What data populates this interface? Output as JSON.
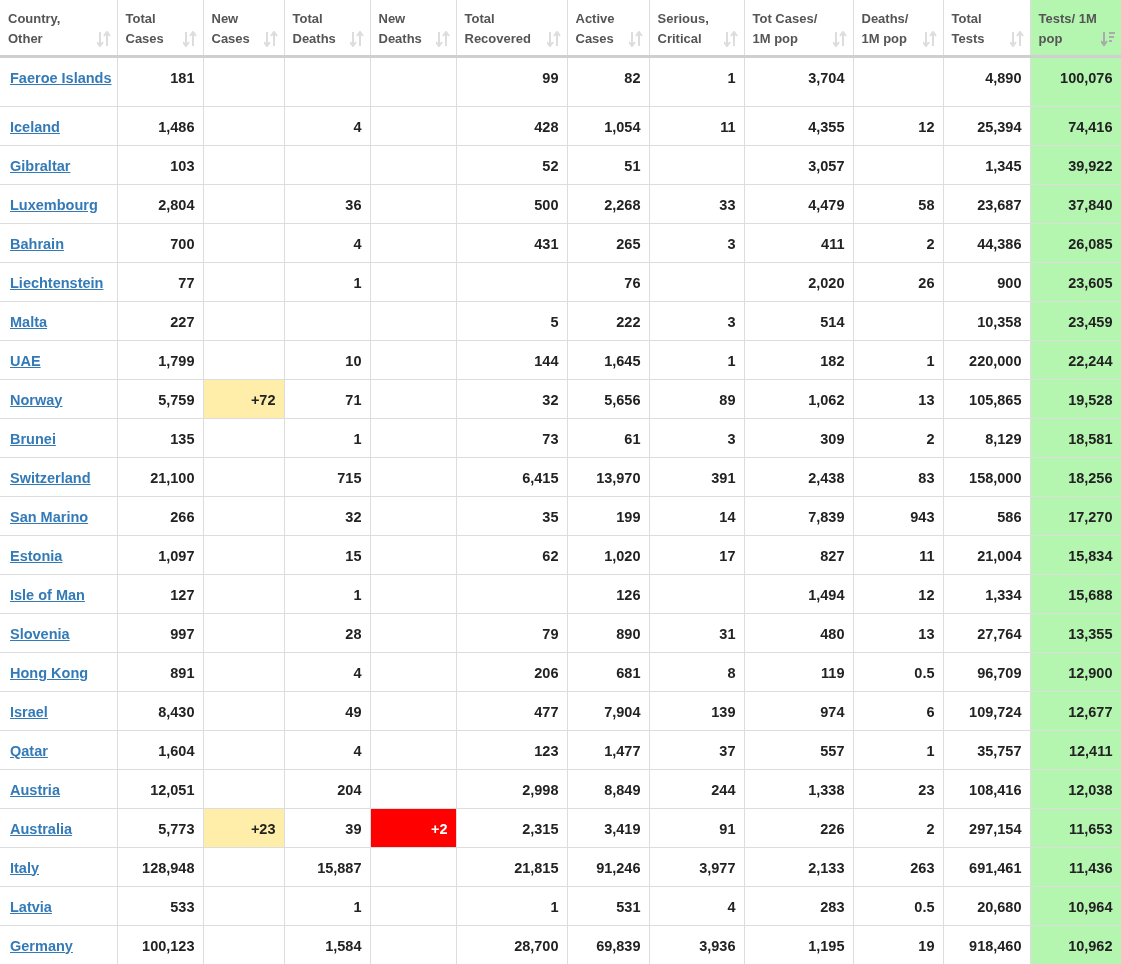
{
  "table": {
    "columns": [
      {
        "label": "Country, Other",
        "kind": "country",
        "sorted": false
      },
      {
        "label": "Total Cases",
        "kind": "number",
        "sorted": false
      },
      {
        "label": "New Cases",
        "kind": "new_cases",
        "sorted": false
      },
      {
        "label": "Total Deaths",
        "kind": "number",
        "sorted": false
      },
      {
        "label": "New Deaths",
        "kind": "new_deaths",
        "sorted": false
      },
      {
        "label": "Total Recovered",
        "kind": "number",
        "sorted": false
      },
      {
        "label": "Active Cases",
        "kind": "number",
        "sorted": false
      },
      {
        "label": "Serious, Critical",
        "kind": "number",
        "sorted": false
      },
      {
        "label": "Tot Cases/ 1M pop",
        "kind": "number",
        "sorted": false
      },
      {
        "label": "Deaths/ 1M pop",
        "kind": "number",
        "sorted": false
      },
      {
        "label": "Total Tests",
        "kind": "number",
        "sorted": false
      },
      {
        "label": "Tests/ 1M pop",
        "kind": "number",
        "sorted": true
      }
    ],
    "rows": [
      [
        "Faeroe Islands",
        "181",
        "",
        "",
        "",
        "99",
        "82",
        "1",
        "3,704",
        "",
        "4,890",
        "100,076"
      ],
      [
        "Iceland",
        "1,486",
        "",
        "4",
        "",
        "428",
        "1,054",
        "11",
        "4,355",
        "12",
        "25,394",
        "74,416"
      ],
      [
        "Gibraltar",
        "103",
        "",
        "",
        "",
        "52",
        "51",
        "",
        "3,057",
        "",
        "1,345",
        "39,922"
      ],
      [
        "Luxembourg",
        "2,804",
        "",
        "36",
        "",
        "500",
        "2,268",
        "33",
        "4,479",
        "58",
        "23,687",
        "37,840"
      ],
      [
        "Bahrain",
        "700",
        "",
        "4",
        "",
        "431",
        "265",
        "3",
        "411",
        "2",
        "44,386",
        "26,085"
      ],
      [
        "Liechtenstein",
        "77",
        "",
        "1",
        "",
        "",
        "76",
        "",
        "2,020",
        "26",
        "900",
        "23,605"
      ],
      [
        "Malta",
        "227",
        "",
        "",
        "",
        "5",
        "222",
        "3",
        "514",
        "",
        "10,358",
        "23,459"
      ],
      [
        "UAE",
        "1,799",
        "",
        "10",
        "",
        "144",
        "1,645",
        "1",
        "182",
        "1",
        "220,000",
        "22,244"
      ],
      [
        "Norway",
        "5,759",
        "+72",
        "71",
        "",
        "32",
        "5,656",
        "89",
        "1,062",
        "13",
        "105,865",
        "19,528"
      ],
      [
        "Brunei",
        "135",
        "",
        "1",
        "",
        "73",
        "61",
        "3",
        "309",
        "2",
        "8,129",
        "18,581"
      ],
      [
        "Switzerland",
        "21,100",
        "",
        "715",
        "",
        "6,415",
        "13,970",
        "391",
        "2,438",
        "83",
        "158,000",
        "18,256"
      ],
      [
        "San Marino",
        "266",
        "",
        "32",
        "",
        "35",
        "199",
        "14",
        "7,839",
        "943",
        "586",
        "17,270"
      ],
      [
        "Estonia",
        "1,097",
        "",
        "15",
        "",
        "62",
        "1,020",
        "17",
        "827",
        "11",
        "21,004",
        "15,834"
      ],
      [
        "Isle of Man",
        "127",
        "",
        "1",
        "",
        "",
        "126",
        "",
        "1,494",
        "12",
        "1,334",
        "15,688"
      ],
      [
        "Slovenia",
        "997",
        "",
        "28",
        "",
        "79",
        "890",
        "31",
        "480",
        "13",
        "27,764",
        "13,355"
      ],
      [
        "Hong Kong",
        "891",
        "",
        "4",
        "",
        "206",
        "681",
        "8",
        "119",
        "0.5",
        "96,709",
        "12,900"
      ],
      [
        "Israel",
        "8,430",
        "",
        "49",
        "",
        "477",
        "7,904",
        "139",
        "974",
        "6",
        "109,724",
        "12,677"
      ],
      [
        "Qatar",
        "1,604",
        "",
        "4",
        "",
        "123",
        "1,477",
        "37",
        "557",
        "1",
        "35,757",
        "12,411"
      ],
      [
        "Austria",
        "12,051",
        "",
        "204",
        "",
        "2,998",
        "8,849",
        "244",
        "1,338",
        "23",
        "108,416",
        "12,038"
      ],
      [
        "Australia",
        "5,773",
        "+23",
        "39",
        "+2",
        "2,315",
        "3,419",
        "91",
        "226",
        "2",
        "297,154",
        "11,653"
      ],
      [
        "Italy",
        "128,948",
        "",
        "15,887",
        "",
        "21,815",
        "91,246",
        "3,977",
        "2,133",
        "263",
        "691,461",
        "11,436"
      ],
      [
        "Latvia",
        "533",
        "",
        "1",
        "",
        "1",
        "531",
        "4",
        "283",
        "0.5",
        "20,680",
        "10,964"
      ],
      [
        "Germany",
        "100,123",
        "",
        "1,584",
        "",
        "28,700",
        "69,839",
        "3,936",
        "1,195",
        "19",
        "918,460",
        "10,962"
      ]
    ]
  }
}
